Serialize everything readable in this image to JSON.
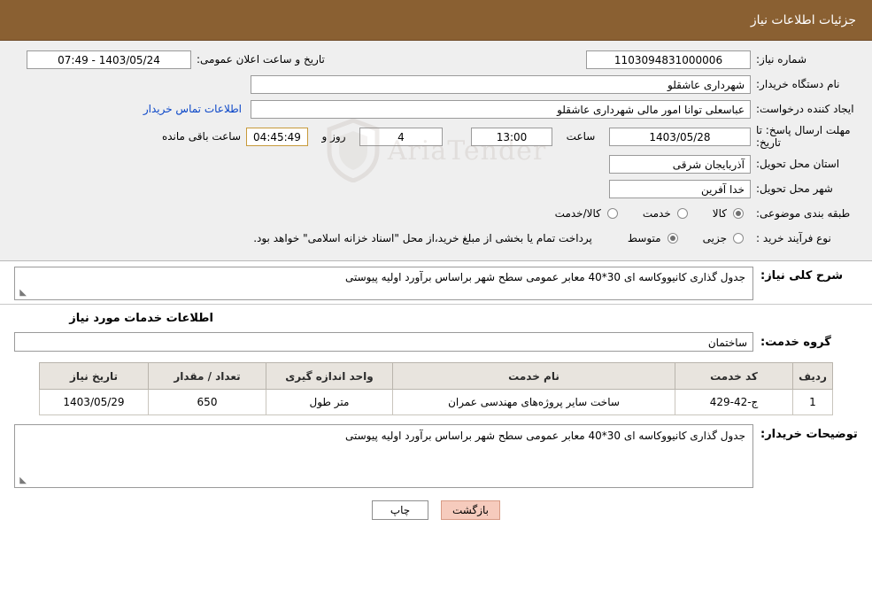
{
  "header": {
    "title": "جزئیات اطلاعات نیاز"
  },
  "form": {
    "need_number_label": "شماره نیاز:",
    "need_number_value": "1103094831000006",
    "announce_date_label": "تاریخ و ساعت اعلان عمومی:",
    "announce_date_value": "1403/05/24 - 07:49",
    "buyer_org_label": "نام دستگاه خریدار:",
    "buyer_org_value": "شهرداری عاشقلو",
    "creator_label": "ایجاد کننده درخواست:",
    "creator_value": "عباسعلی  توانا امور مالی شهرداری عاشقلو",
    "contact_link": "اطلاعات تماس خریدار",
    "deadline_label": "مهلت ارسال پاسخ: تا تاریخ:",
    "deadline_date": "1403/05/28",
    "hour_label": "ساعت",
    "deadline_time": "13:00",
    "days_value": "4",
    "days_label": "روز و",
    "remaining_time": "04:45:49",
    "remaining_label": "ساعت باقی مانده",
    "province_label": "استان محل تحویل:",
    "province_value": "آذربایجان شرقی",
    "city_label": "شهر محل تحویل:",
    "city_value": "خدا آفرین",
    "category_label": "طبقه بندی موضوعی:",
    "category_options": [
      "کالا",
      "خدمت",
      "کالا/خدمت"
    ],
    "category_selected": "کالا",
    "purchase_type_label": "نوع فرآیند خرید :",
    "purchase_type_options": [
      "جزیی",
      "متوسط"
    ],
    "purchase_type_selected": "متوسط",
    "purchase_note": "پرداخت تمام یا بخشی از مبلغ خرید،از محل \"اسناد خزانه اسلامی\" خواهد بود."
  },
  "summary": {
    "label": "شرح کلی نیاز:",
    "text": "جدول گذاری کانیووکاسه ای 30*40 معابر عمومی سطح شهر براساس برآورد اولیه پیوستی"
  },
  "services": {
    "section_title": "اطلاعات خدمات مورد نیاز",
    "group_label": "گروه خدمت:",
    "group_value": "ساختمان",
    "columns": [
      "ردیف",
      "کد خدمت",
      "نام خدمت",
      "واحد اندازه گیری",
      "تعداد / مقدار",
      "تاریخ نیاز"
    ],
    "rows": [
      {
        "index": "1",
        "code": "ج-42-429",
        "name": "ساخت سایر پروژه‌های مهندسی عمران",
        "unit": "متر طول",
        "quantity": "650",
        "date": "1403/05/29"
      }
    ]
  },
  "notes": {
    "label": "توضیحات خریدار:",
    "text": "جدول گذاری کانیووکاسه ای 30*40 معابر عمومی سطح شهر براساس برآورد اولیه پیوستی"
  },
  "footer": {
    "back_button": "بازگشت",
    "print_button": "چاپ"
  },
  "watermark": {
    "text": "AriaTender"
  }
}
